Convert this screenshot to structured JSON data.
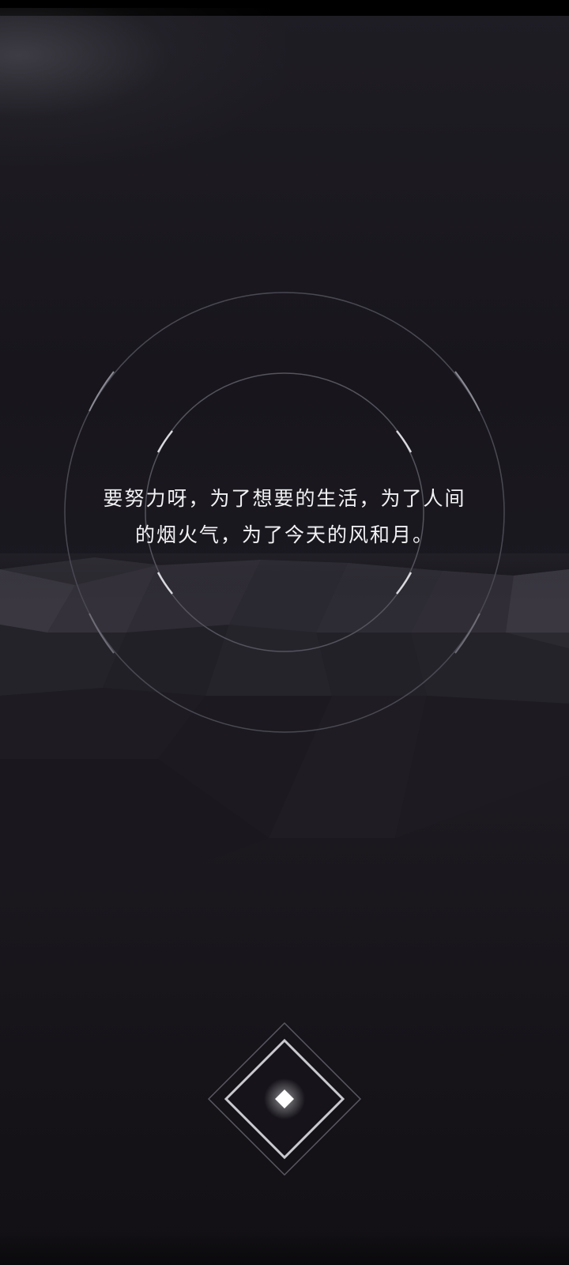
{
  "quote": {
    "line1": "要努力呀，为了想要的生活，为了人间",
    "line2": "的烟火气，为了今天的风和月。"
  },
  "icons": {
    "start": "diamond-start-icon"
  },
  "colors": {
    "background_top": "#1f1d24",
    "background_bottom": "#121014",
    "text": "#f2f2f4",
    "accent": "#ffffff"
  }
}
